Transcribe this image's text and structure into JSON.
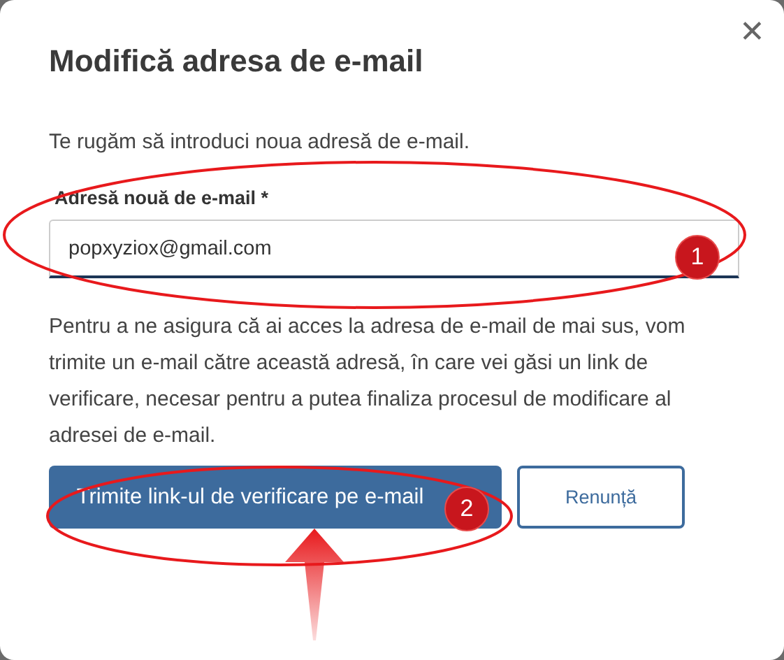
{
  "dialog": {
    "title": "Modifică adresa de e-mail",
    "close": "✕",
    "intro": "Te rugăm să introduci noua adresă de e-mail.",
    "field": {
      "label": "Adresă nouă de e-mail *",
      "value": "popxyziox@gmail.com"
    },
    "explanation": "Pentru a ne asigura că ai acces la adresa de e-mail de mai sus, vom trimite un e-mail către această adresă, în care vei găsi un link de verificare, necesar pentru a putea finaliza procesul de modificare al adresei de e-mail.",
    "buttons": [
      {
        "label": "Trimite link-ul de verificare pe e-mail",
        "kind": "primary"
      },
      {
        "label": "Renunță",
        "kind": "secondary"
      }
    ]
  },
  "annotations": [
    {
      "number": "1"
    },
    {
      "number": "2"
    }
  ]
}
